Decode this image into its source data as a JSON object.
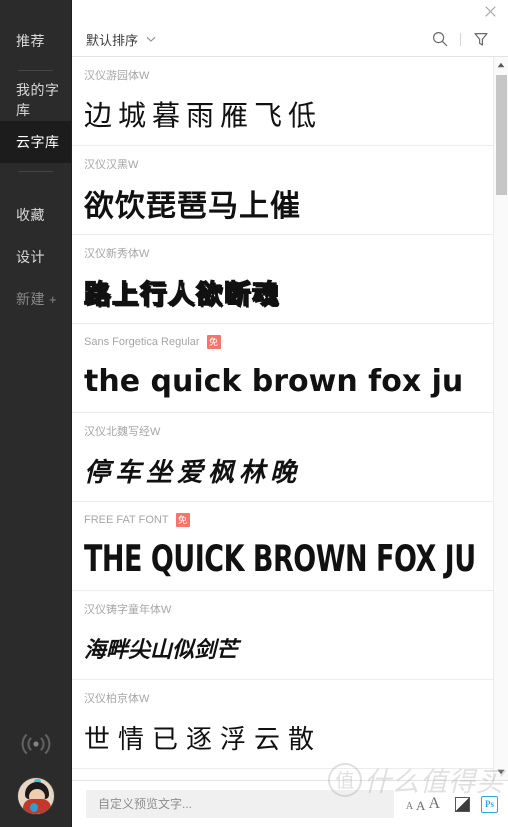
{
  "window": {
    "close_label": "×"
  },
  "sidebar": {
    "items": [
      {
        "label": "推荐",
        "name": "recommend"
      },
      {
        "label": "我的字库",
        "name": "my-fonts"
      },
      {
        "label": "云字库",
        "name": "cloud-fonts"
      },
      {
        "label": "收藏",
        "name": "favorites"
      },
      {
        "label": "设计",
        "name": "design"
      },
      {
        "label": "新建",
        "name": "new",
        "suffix": "+"
      }
    ],
    "active": "云字库",
    "bottom": {
      "sync_icon": "wifi-icon",
      "avatar_icon": "user-avatar"
    }
  },
  "toolbar": {
    "sort_label": "默认排序",
    "sort_caret": "⌄",
    "search_icon": "search-icon",
    "filter_icon": "filter-icon"
  },
  "list": {
    "rows": [
      {
        "font_name": "汉仪游园体W",
        "preview": "边城暮雨雁飞低",
        "style": "pv-thin-cjk",
        "badge": null,
        "action": "check",
        "action_state": "off"
      },
      {
        "font_name": "汉仪汉黑W",
        "preview": "欲饮琵琶马上催",
        "style": "pv-bold-cjk",
        "badge": null,
        "action": "check",
        "action_state": "on"
      },
      {
        "font_name": "汉仪新秀体W",
        "preview": "路上行人欲断魂",
        "style": "pv-outline-cjk",
        "badge": null,
        "action": "check",
        "action_state": "on"
      },
      {
        "font_name": "Sans Forgetica Regular",
        "preview": "the quick brown fox ju",
        "style": "pv-latin-display",
        "badge": "免",
        "action": "star",
        "action_state": "off"
      },
      {
        "font_name": "汉仪北魏写经W",
        "preview": "停车坐爱枫林晚",
        "style": "pv-brush-cjk",
        "badge": null,
        "action": "check",
        "action_state": "off"
      },
      {
        "font_name": "FREE FAT FONT",
        "preview": "THE QUICK BROWN FOX JU",
        "style": "pv-fat-latin",
        "badge": "免",
        "action": "check",
        "action_state": "off"
      },
      {
        "font_name": "汉仪铸字童年体W",
        "preview": "海畔尖山似剑芒",
        "style": "pv-child-cjk",
        "badge": null,
        "action": "check",
        "action_state": "off"
      },
      {
        "font_name": "汉仪柏京体W",
        "preview": "世情已逐浮云散",
        "style": "pv-geo-cjk",
        "badge": null,
        "action": "check",
        "action_state": "off"
      }
    ]
  },
  "scrollbar": {
    "up_icon": "scroll-up-arrow",
    "down_icon": "scroll-down-arrow"
  },
  "bottombar": {
    "input_placeholder": "自定义预览文字...",
    "input_value": "",
    "size_small": "A",
    "size_medium": "A",
    "size_large": "A",
    "contrast_icon": "contrast-icon",
    "ps_label": "Ps"
  },
  "watermark": {
    "mark": "值",
    "text": "什么值得买"
  },
  "colors": {
    "sidebar_bg": "#2b2b2b",
    "sidebar_active_bg": "#1c1c1c",
    "accent_green": "#27ae3f",
    "badge_red": "#f5756b",
    "ps_blue": "#2aa9e0"
  }
}
